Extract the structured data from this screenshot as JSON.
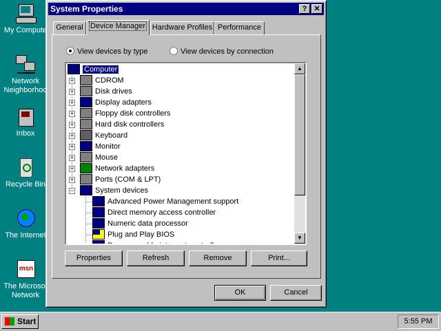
{
  "desktop": {
    "icons": [
      {
        "label": "My Compute"
      },
      {
        "label": "Network Neighborhoo"
      },
      {
        "label": "Inbox"
      },
      {
        "label": "Recycle Bin"
      },
      {
        "label": "The Internet"
      },
      {
        "label": "The Microsof Network"
      }
    ]
  },
  "window": {
    "title": "System Properties",
    "help_btn": "?",
    "close_btn": "✕",
    "tabs": [
      "General",
      "Device Manager",
      "Hardware Profiles",
      "Performance"
    ],
    "active_tab": "Device Manager",
    "radio_by_type": "View devices by type",
    "radio_by_connection": "View devices by connection",
    "tree": {
      "root": "Computer",
      "categories": [
        "CDROM",
        "Disk drives",
        "Display adapters",
        "Floppy disk controllers",
        "Hard disk controllers",
        "Keyboard",
        "Monitor",
        "Mouse",
        "Network adapters",
        "Ports (COM & LPT)",
        "System devices"
      ],
      "expanded": "System devices",
      "system_devices": [
        "Advanced Power Management support",
        "Direct memory access controller",
        "Numeric data processor",
        "Plug and Play BIOS",
        "Programmable interrupt controller"
      ]
    },
    "buttons": {
      "properties": "Properties",
      "refresh": "Refresh",
      "remove": "Remove",
      "print": "Print..."
    },
    "ok": "OK",
    "cancel": "Cancel"
  },
  "taskbar": {
    "start": "Start",
    "clock": "5:55 PM"
  },
  "colors": {
    "desktop": "#008080",
    "titlebar": "#000080",
    "face": "#c0c0c0",
    "selection": "#000080"
  }
}
